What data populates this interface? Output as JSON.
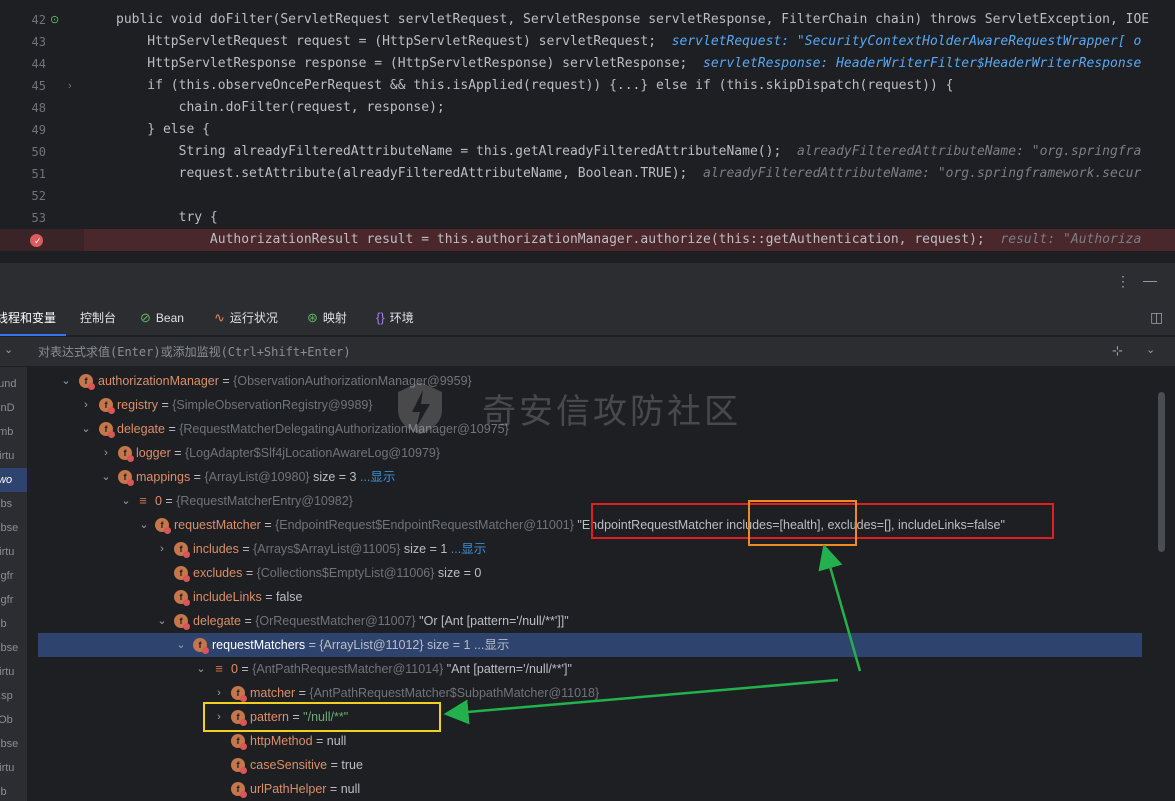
{
  "editor": {
    "lines": [
      {
        "num": "42",
        "code": "public void doFilter(ServletRequest servletRequest, ServletResponse servletResponse, FilterChain chain) throws ServletException, IOE"
      },
      {
        "num": "43",
        "code": "    HttpServletRequest request = (HttpServletRequest) servletRequest;",
        "inline": "servletRequest: \"SecurityContextHolderAwareRequestWrapper[ o"
      },
      {
        "num": "44",
        "code": "    HttpServletResponse response = (HttpServletResponse) servletResponse;",
        "inline": "servletResponse: HeaderWriterFilter$HeaderWriterResponse"
      },
      {
        "num": "45",
        "code": "    if (this.observeOncePerRequest && this.isApplied(request)) {...} else if (this.skipDispatch(request)) {"
      },
      {
        "num": "48",
        "code": "        chain.doFilter(request, response);"
      },
      {
        "num": "49",
        "code": "    } else {"
      },
      {
        "num": "50",
        "code": "        String alreadyFilteredAttributeName = this.getAlreadyFilteredAttributeName();",
        "inline": "alreadyFilteredAttributeName: \"org.springfra"
      },
      {
        "num": "51",
        "code": "        request.setAttribute(alreadyFilteredAttributeName, Boolean.TRUE);",
        "inline": "alreadyFilteredAttributeName: \"org.springframework.secur"
      },
      {
        "num": "52",
        "code": ""
      },
      {
        "num": "53",
        "code": "        try {"
      },
      {
        "num": "",
        "code": "            AuthorizationResult result = this.authorizationManager.authorize(this::getAuthentication, request);",
        "inline": "result: \"Authoriza"
      }
    ]
  },
  "tabs": [
    {
      "label": "线程和变量",
      "icon": ""
    },
    {
      "label": "控制台",
      "icon": ""
    },
    {
      "label": "Bean",
      "icon": "bean-icon"
    },
    {
      "label": "运行状况",
      "icon": "health-icon"
    },
    {
      "label": "映射",
      "icon": "mapping-icon"
    },
    {
      "label": "环境",
      "icon": "environment-icon"
    }
  ],
  "eval": {
    "placeholder": "对表达式求值(Enter)或添加监视(Ctrl+Shift+Enter)"
  },
  "frames": [
    "ound",
    "ainD",
    "amb",
    "Virtu",
    "ewo",
    "Obs",
    "Obse",
    "Virtu",
    "ingfr",
    "ingfr",
    "Ob",
    "Obse",
    "Virtu",
    "g.sp",
    "$Ob",
    "Obse",
    "Virtu",
    "Ob"
  ],
  "watermark": "奇安信攻防社区",
  "vars": [
    {
      "name": "authorizationManager",
      "type": "{ObservationAuthorizationManager@9959}"
    },
    {
      "name": "registry",
      "type": "{SimpleObservationRegistry@9989}"
    },
    {
      "name": "delegate",
      "type": "{RequestMatcherDelegatingAuthorizationManager@10975}"
    },
    {
      "name": "logger",
      "type": "{LogAdapter$Slf4jLocationAwareLog@10979}"
    },
    {
      "name": "mappings",
      "type": "{ArrayList@10980}",
      "size": "size = 3",
      "link": "...显示"
    },
    {
      "name": "0",
      "type": "{RequestMatcherEntry@10982}"
    },
    {
      "name": "requestMatcher",
      "type": "{EndpointRequest$EndpointRequestMatcher@11001}",
      "str": "\"EndpointRequestMatcher includes=[health], excludes=[], includeLinks=false\""
    },
    {
      "name": "includes",
      "type": "{Arrays$ArrayList@11005}",
      "size": "size = 1",
      "link": "...显示"
    },
    {
      "name": "excludes",
      "type": "{Collections$EmptyList@11006}",
      "size": "size = 0"
    },
    {
      "name": "includeLinks",
      "value": "false"
    },
    {
      "name": "delegate",
      "type": "{OrRequestMatcher@11007}",
      "str": "\"Or [Ant [pattern='/null/**']]\""
    },
    {
      "name": "requestMatchers",
      "type": "{ArrayList@11012}",
      "size": "size = 1",
      "link": "...显示"
    },
    {
      "name": "0",
      "type": "{AntPathRequestMatcher@11014}",
      "str": "\"Ant [pattern='/null/**']\""
    },
    {
      "name": "matcher",
      "type": "{AntPathRequestMatcher$SubpathMatcher@11018}"
    },
    {
      "name": "pattern",
      "valueStr": "\"/null/**\""
    },
    {
      "name": "httpMethod",
      "value": "null"
    },
    {
      "name": "caseSensitive",
      "value": "true"
    },
    {
      "name": "urlPathHelper",
      "value": "null"
    }
  ],
  "colors": {
    "annotation_red": "#e02020",
    "annotation_orange": "#f08a24",
    "annotation_yellow": "#f2d01e",
    "arrow_green": "#22b14c"
  }
}
